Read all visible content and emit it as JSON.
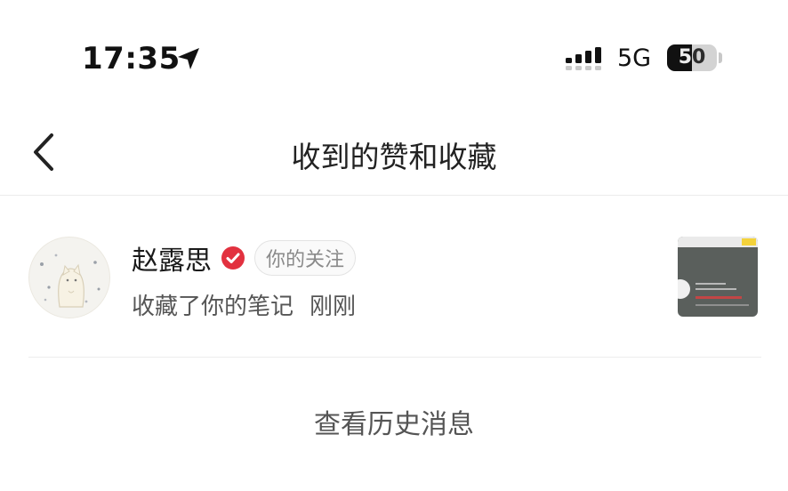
{
  "status_bar": {
    "time": "17:35",
    "network": "5G",
    "battery_level": "50",
    "battery_fraction": 0.5
  },
  "header": {
    "title": "收到的赞和收藏"
  },
  "notification": {
    "username": "赵露思",
    "follow_badge": "你的关注",
    "action": "收藏了你的笔记",
    "timestamp": "刚刚"
  },
  "footer": {
    "history_link": "查看历史消息"
  },
  "colors": {
    "verified_badge": "#e2313f",
    "divider": "#ececec",
    "secondary_text": "#555555"
  }
}
